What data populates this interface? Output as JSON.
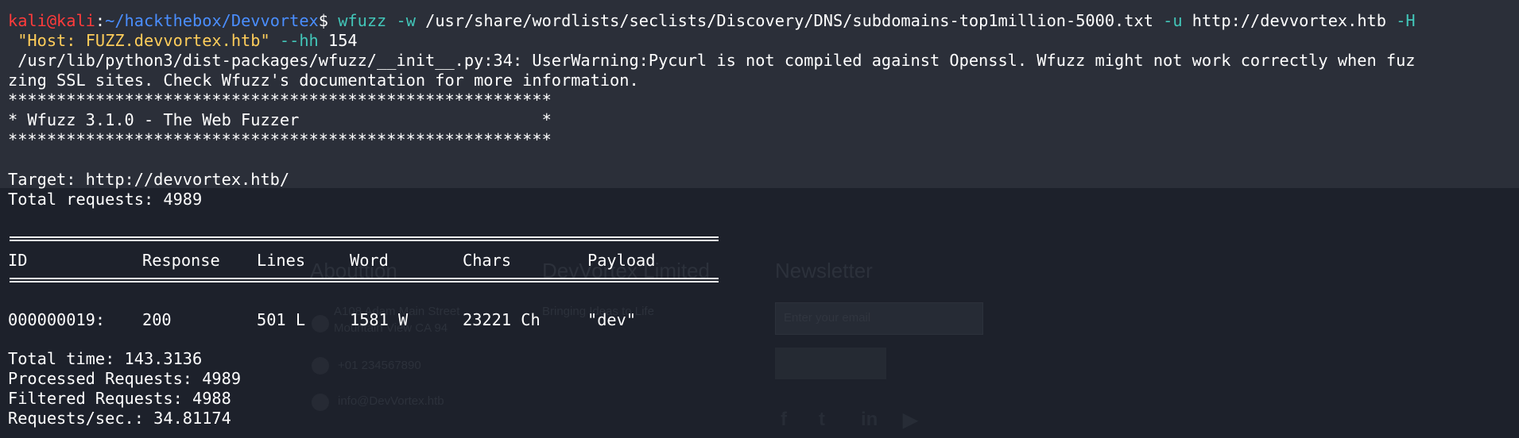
{
  "prompt": {
    "user_host": "kali@kali",
    "sep": ":",
    "path": "~/hackthebox/Devvortex",
    "symbol": "$"
  },
  "command": {
    "program": "wfuzz",
    "flag_w": "-w",
    "wordlist": "/usr/share/wordlists/seclists/Discovery/DNS/subdomains-top1million-5000.txt",
    "flag_u": "-u",
    "url": "http://devvortex.htb",
    "flag_H": "-H",
    "header": "\"Host: FUZZ.devvortex.htb\"",
    "flag_hh": "--hh",
    "hh_value": "154"
  },
  "warning": {
    "line1": " /usr/lib/python3/dist-packages/wfuzz/__init__.py:34: UserWarning:Pycurl is not compiled against Openssl. Wfuzz might not work correctly when fuz",
    "line2": "zing SSL sites. Check Wfuzz's documentation for more information."
  },
  "banner": {
    "stars": "********************************************************",
    "title": "* Wfuzz 3.1.0 - The Web Fuzzer                         *"
  },
  "target": {
    "target_line": "Target: http://devvortex.htb/",
    "total_requests_line": "Total requests: 4989"
  },
  "results": {
    "headers": [
      "ID",
      "Response",
      "Lines",
      "Word",
      "Chars",
      "Payload"
    ],
    "rows": [
      [
        "000000019:",
        "200",
        "501 L",
        "1581 W",
        "23221 Ch",
        "\"dev\""
      ]
    ]
  },
  "summary": {
    "total_time": "Total time: 143.3136",
    "processed": "Processed Requests: 4989",
    "filtered": "Filtered Requests: 4988",
    "rate": "Requests/sec.: 34.81174"
  },
  "colors": {
    "prompt_user": "#ff3b3b",
    "prompt_path": "#4a8eff",
    "flags": "#42c6b9",
    "string": "#ffcd5a",
    "background": "#1d212b"
  }
}
